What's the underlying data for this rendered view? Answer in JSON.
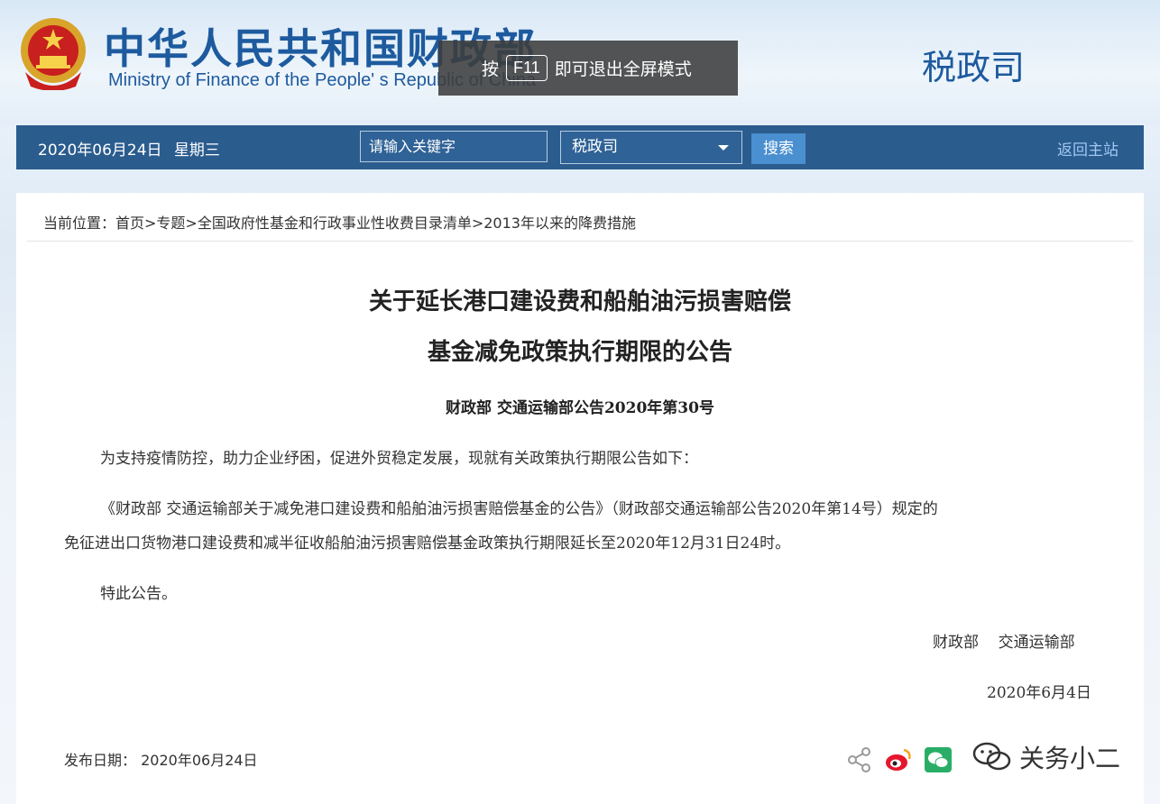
{
  "header": {
    "site_name_cn": "中华人民共和国财政部",
    "site_name_en": "Ministry of Finance of the People' s Republic of China",
    "department": "税政司"
  },
  "fullscreen_hint": {
    "prefix": "按",
    "key": "F11",
    "suffix": "即可退出全屏模式"
  },
  "navbar": {
    "date": "2020年06月24日",
    "weekday": "星期三",
    "search_placeholder": "请输入关键字",
    "select_value": "税政司",
    "search_button": "搜索",
    "home_link": "返回主站"
  },
  "breadcrumb": {
    "label": "当前位置：",
    "path": "首页>专题>全国政府性基金和行政事业性收费目录清单>2013年以来的降费措施"
  },
  "article": {
    "title_line1": "关于延长港口建设费和船舶油污损害赔偿",
    "title_line2": "基金减免政策执行期限的公告",
    "doc_number": "财政部  交通运输部公告2020年第30号",
    "paragraph1": "为支持疫情防控，助力企业纾困，促进外贸稳定发展，现就有关政策执行期限公告如下：",
    "paragraph2_line1": "《财政部 交通运输部关于减免港口建设费和船舶油污损害赔偿基金的公告》（财政部交通运输部公告2020年第14号）规定的",
    "paragraph2_line2": "免征进出口货物港口建设费和减半征收船舶油污损害赔偿基金政策执行期限延长至2020年12月31日24时。",
    "paragraph3": "特此公告。",
    "signature": "财政部    交通运输部",
    "sign_date": "2020年6月4日",
    "publish_label": "发布日期：",
    "publish_date": "2020年06月24日"
  },
  "share_icons": [
    "share-icon",
    "weibo-icon",
    "wechat-icon"
  ],
  "watermark": {
    "text": "关务小二",
    "icon": "wechat-official-icon"
  },
  "colors": {
    "brand_blue": "#1d5a9e",
    "navbar": "#2b5c8e",
    "search_button": "#4a8fd0",
    "weibo": "#e6162d",
    "wechat": "#2aae67"
  }
}
